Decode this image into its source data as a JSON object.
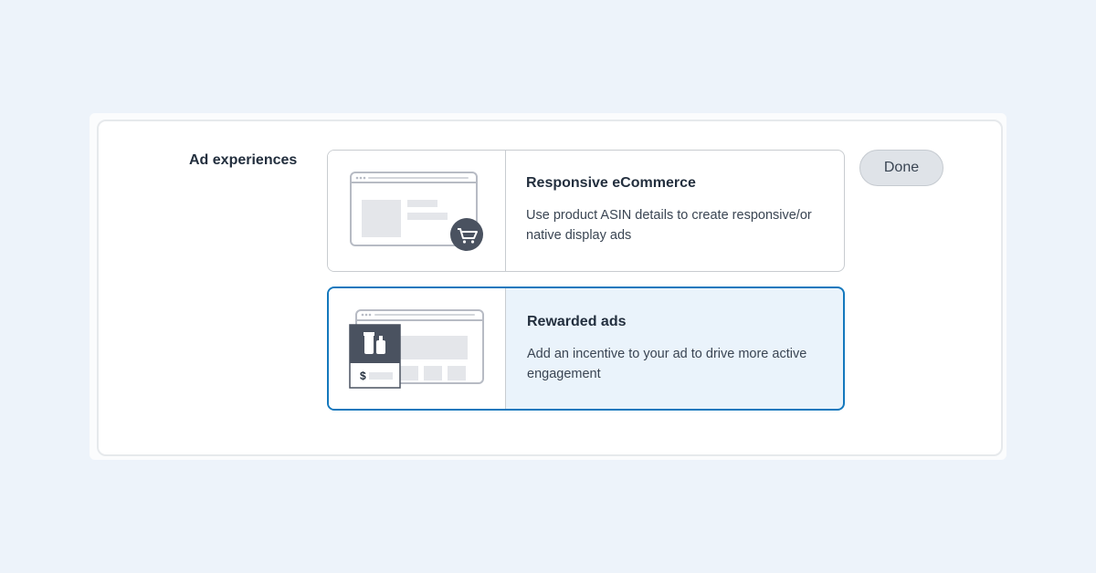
{
  "section": {
    "label": "Ad experiences"
  },
  "options": [
    {
      "title": "Responsive eCommerce",
      "description": "Use product ASIN details to create responsive/or native display ads",
      "icon": "shopping-cart-icon",
      "selected": false
    },
    {
      "title": "Rewarded ads",
      "description": "Add an incentive to your ad to drive more active engagement",
      "icon": "reward-products-icon",
      "price_symbol": "$",
      "selected": true
    }
  ],
  "done_button": {
    "label": "Done"
  },
  "colors": {
    "page_background": "#edf3fa",
    "selected_border": "#1478bd",
    "selected_background": "#eaf3fb",
    "icon_dark": "#4a5260",
    "text_primary": "#232f3e"
  }
}
